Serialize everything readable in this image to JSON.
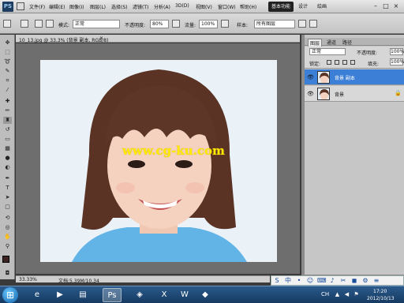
{
  "app": {
    "logo": "PS"
  },
  "menubar": {
    "items": [
      "文件(F)",
      "编辑(E)",
      "图像(I)",
      "图层(L)",
      "选择(S)",
      "滤镜(T)",
      "分析(A)",
      "3D(D)",
      "视图(V)",
      "窗口(W)",
      "帮助(H)"
    ],
    "zoom": "33.3",
    "workspaces": [
      "基本功能",
      "设计",
      "绘画"
    ],
    "window_controls": [
      "–",
      "□",
      "×"
    ]
  },
  "options": {
    "mode_label": "模式:",
    "mode_value": "正常",
    "opacity_label": "不透明度:",
    "opacity_value": "80%",
    "flow_label": "流量:",
    "flow_value": "100%",
    "sample_label": "样本:",
    "sample_value": "所有图层"
  },
  "document": {
    "tab_title": "10_13.jpg @ 33.3% (背景 副本, RGB/8)",
    "close": "×",
    "watermark": "www.cg-ku.com"
  },
  "status": {
    "zoom": "33.33%",
    "doc_size": "文档:5.39M/10.34"
  },
  "panel": {
    "tabs": [
      "图层",
      "通道",
      "路径"
    ],
    "blend_mode": "正常",
    "opacity_label": "不透明度:",
    "opacity_value": "100%",
    "lock_label": "锁定:",
    "fill_label": "填充:",
    "fill_value": "100%",
    "layers": [
      {
        "name": "背景 副本",
        "visible": true,
        "selected": true
      },
      {
        "name": "背景",
        "visible": true,
        "selected": false
      }
    ]
  },
  "taskbar": {
    "time": "17:20",
    "date": "2012/10/13"
  }
}
